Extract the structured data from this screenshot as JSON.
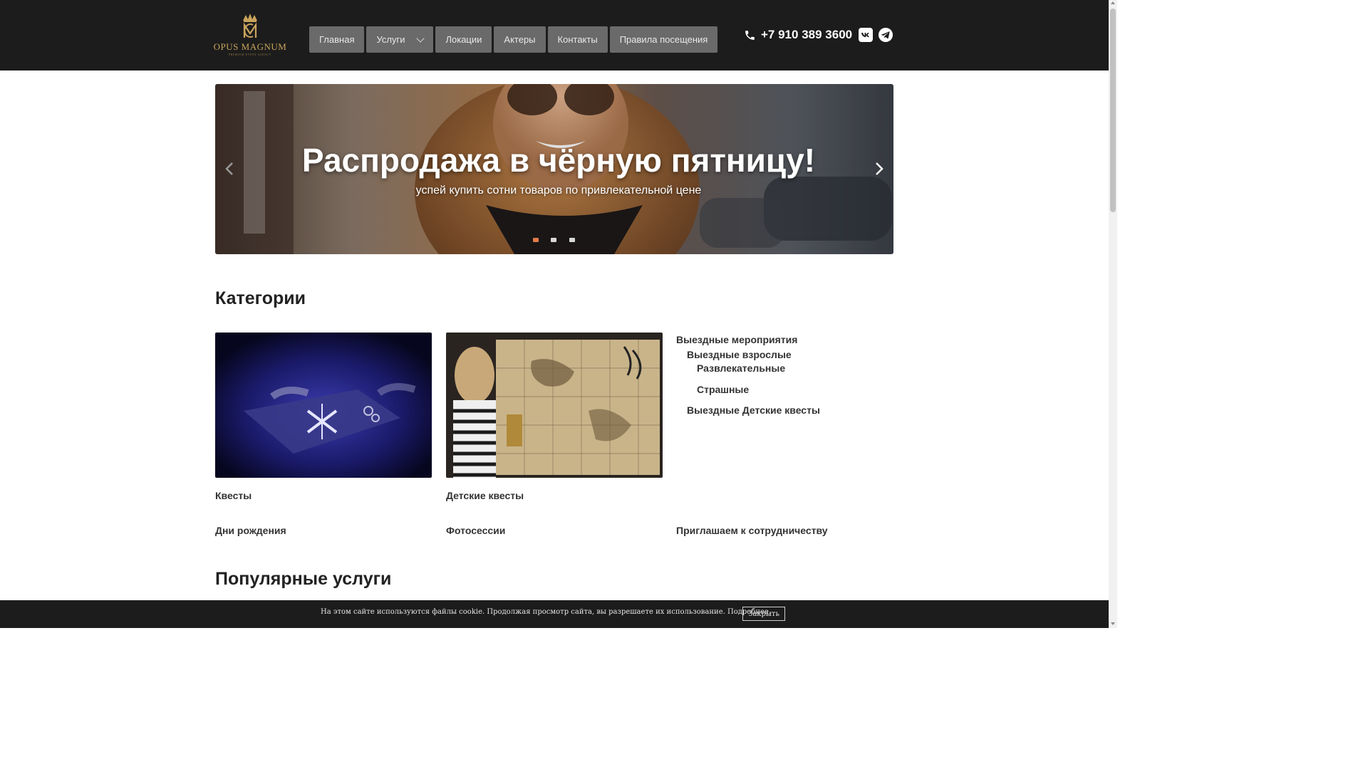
{
  "header": {
    "logo_text": "OPUS MAGNUM",
    "logo_subtext": "PREMIUM EVENT AGENCY",
    "nav": [
      {
        "label": "Главная"
      },
      {
        "label": "Услуги",
        "has_dropdown": true
      },
      {
        "label": "Локации"
      },
      {
        "label": "Актеры"
      },
      {
        "label": "Контакты"
      },
      {
        "label": "Правила посещения"
      }
    ],
    "phone": "+7 910 389 3600",
    "social_icons": [
      "vk-icon",
      "telegram-icon"
    ]
  },
  "slider": {
    "title": "Распродажа в чёрную пятницу!",
    "subtitle": "успей купить сотни товаров по привлекательной цене",
    "dots_count": 3,
    "active_dot": 0
  },
  "categories": {
    "heading": "Категории",
    "cards": [
      {
        "label": "Квесты"
      },
      {
        "label": "Детские квесты"
      }
    ],
    "tree": {
      "root": "Выездные мероприятия",
      "level1": [
        "Выездные взрослые",
        "Выездные Детские квесты"
      ],
      "level2": [
        "Развлекательные",
        "Страшные"
      ]
    },
    "links": [
      "Дни рождения",
      "Фотосессии",
      "Приглашаем к сотрудничеству"
    ]
  },
  "popular": {
    "heading": "Популярные услуги"
  },
  "cookie": {
    "text": "На этом сайте используются файлы cookie. Продолжая просмотр сайта, вы разрешаете их использование. Подробнее.",
    "button": "Закрыть"
  },
  "colors": {
    "header_bg": "#1c1c1c",
    "nav_bg": "#6a6a6a",
    "gold": "#c9a45c",
    "active_dot": "#e07b4a"
  }
}
